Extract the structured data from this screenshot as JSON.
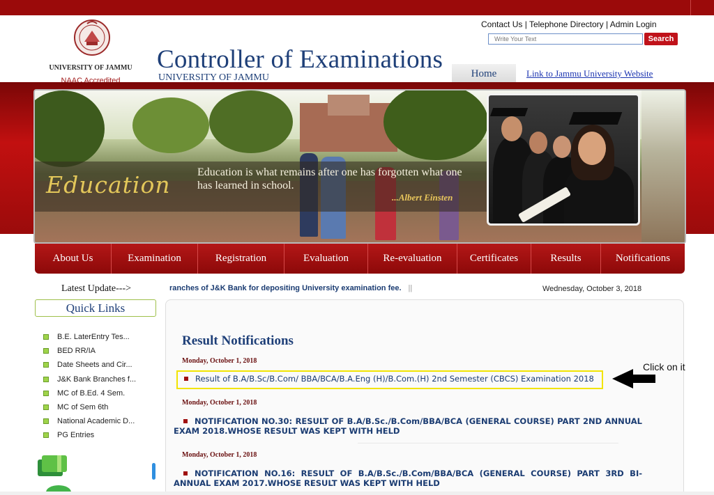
{
  "header": {
    "university_label": "UNIVERSITY OF JAMMU",
    "naac": "NAAC Accredited",
    "title": "Controller of Examinations",
    "subtitle": "UNIVERSITY OF JAMMU",
    "top_links": [
      "Contact Us",
      "Telephone Directory",
      "Admin Login"
    ],
    "search_placeholder": "Write Your Text",
    "search_button": "Search",
    "home_tab": "Home",
    "jammu_link": "Link to Jammu University Website"
  },
  "banner": {
    "word": "Education",
    "quote": "Education is what remains after one has forgotten what one has learned in school.",
    "author": "...Albert Einsten"
  },
  "nav": [
    "About Us",
    "Examination",
    "Registration",
    "Evaluation",
    "Re-evaluation",
    "Certificates",
    "Results",
    "Notifications"
  ],
  "ticker": {
    "label": "Latest Update--->",
    "text": "ranches of J&K Bank for depositing University examination fee.",
    "separator": "||",
    "date": "Wednesday, October 3, 2018"
  },
  "quick_links": {
    "title": "Quick Links",
    "items": [
      "B.E. LaterEntry Tes...",
      "BED RR/IA",
      "Date Sheets and Cir...",
      "J&K Bank Branches f...",
      "MC of B.Ed. 4 Sem.",
      "MC of Sem 6th",
      "National Academic D...",
      "PG Entries"
    ]
  },
  "results": {
    "title": "Result Notifications",
    "notifications": [
      {
        "date": "Monday, October 1, 2018",
        "text": "Result of B.A/B.Sc/B.Com/ BBA/BCA/B.A.Eng (H)/B.Com.(H) 2nd Semester (CBCS) Examination 2018"
      },
      {
        "date": "Monday, October 1, 2018",
        "text": "NOTIFICATION NO.30: RESULT OF B.A/B.Sc./B.Com/BBA/BCA (GENERAL COURSE) PART 2ND ANNUAL EXAM 2018.WHOSE RESULT WAS KEPT WITH HELD"
      },
      {
        "date": "Monday, October 1, 2018",
        "text": "NOTIFICATION NO.16: RESULT OF B.A/B.Sc./B.Com/BBA/BCA (GENERAL COURSE) PART 3RD BI-ANNUAL EXAM 2017.WHOSE RESULT WAS KEPT WITH HELD"
      }
    ]
  },
  "annotation": {
    "label": "Click on it"
  },
  "colors": {
    "brand_red": "#b41717",
    "title_blue": "#1e3f78",
    "link_blue": "#1b3c72",
    "highlight": "#f2e400",
    "bullet_green": "#9fd44a"
  }
}
